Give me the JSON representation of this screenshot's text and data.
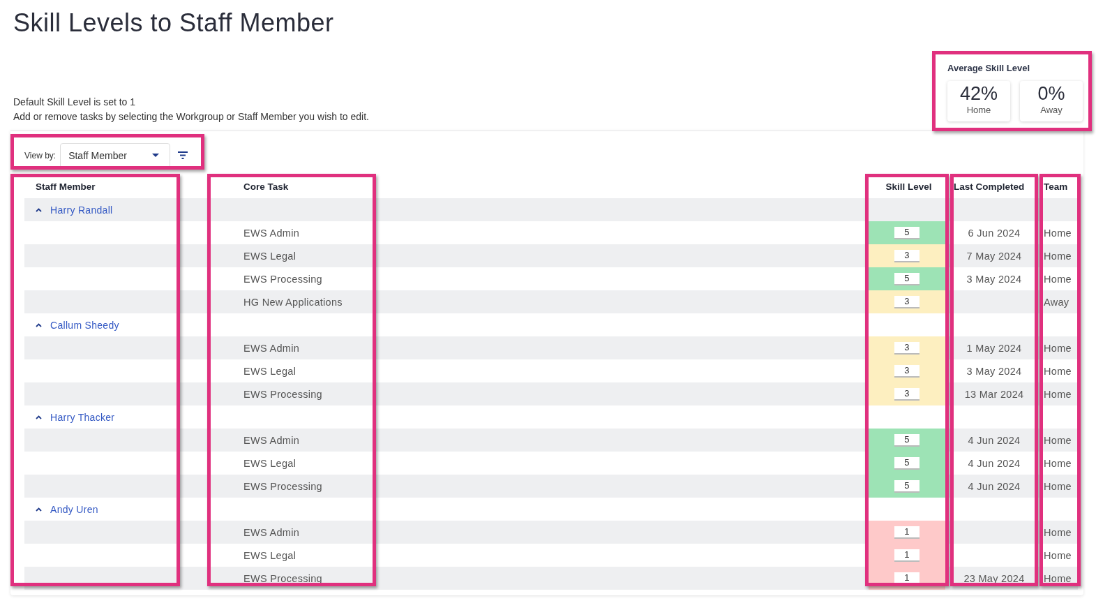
{
  "page": {
    "title": "Skill Levels to Staff Member"
  },
  "notes": [
    "Default Skill Level is set to 1",
    "Add or remove tasks by selecting the Workgroup or Staff Member you wish to edit."
  ],
  "summary": {
    "title": "Average Skill Level",
    "tiles": [
      {
        "value": "42%",
        "label": "Home"
      },
      {
        "value": "0%",
        "label": "Away"
      }
    ]
  },
  "view_by": {
    "label": "View by:",
    "value": "Staff Member"
  },
  "table": {
    "columns": [
      "Staff Member",
      "Core Task",
      "Skill Level",
      "Last Completed",
      "Team"
    ],
    "groups": [
      {
        "name": "Harry Randall",
        "expanded": true,
        "tasks": [
          {
            "task": "EWS Admin",
            "skill": "5",
            "color": "#9de3b5",
            "last_completed": "6 Jun 2024",
            "team": "Home"
          },
          {
            "task": "EWS Legal",
            "skill": "3",
            "color": "#fdefc0",
            "last_completed": "7 May 2024",
            "team": "Home"
          },
          {
            "task": "EWS Processing",
            "skill": "5",
            "color": "#9de3b5",
            "last_completed": "3 May 2024",
            "team": "Home"
          },
          {
            "task": "HG New Applications",
            "skill": "3",
            "color": "#fdefc0",
            "team": "Away"
          }
        ]
      },
      {
        "name": "Callum Sheedy",
        "expanded": true,
        "tasks": [
          {
            "task": "EWS Admin",
            "skill": "3",
            "color": "#fdefc0",
            "last_completed": "1 May 2024",
            "team": "Home"
          },
          {
            "task": "EWS Legal",
            "skill": "3",
            "color": "#fdefc0",
            "last_completed": "3 May 2024",
            "team": "Home"
          },
          {
            "task": "EWS Processing",
            "skill": "3",
            "color": "#fdefc0",
            "last_completed": "13 Mar 2024",
            "team": "Home"
          }
        ]
      },
      {
        "name": "Harry Thacker",
        "expanded": true,
        "tasks": [
          {
            "task": "EWS Admin",
            "skill": "5",
            "color": "#9de3b5",
            "last_completed": "4 Jun 2024",
            "team": "Home"
          },
          {
            "task": "EWS Legal",
            "skill": "5",
            "color": "#9de3b5",
            "last_completed": "4 Jun 2024",
            "team": "Home"
          },
          {
            "task": "EWS Processing",
            "skill": "5",
            "color": "#9de3b5",
            "last_completed": "4 Jun 2024",
            "team": "Home"
          }
        ]
      },
      {
        "name": "Andy Uren",
        "expanded": true,
        "tasks": [
          {
            "task": "EWS Admin",
            "skill": "1",
            "color": "#fec9c9",
            "team": "Home"
          },
          {
            "task": "EWS Legal",
            "skill": "1",
            "color": "#fec9c9",
            "team": "Home"
          },
          {
            "task": "EWS Processing",
            "skill": "1",
            "color": "#fec9c9",
            "last_completed": "23 May 2024",
            "team": "Home"
          }
        ]
      }
    ]
  }
}
